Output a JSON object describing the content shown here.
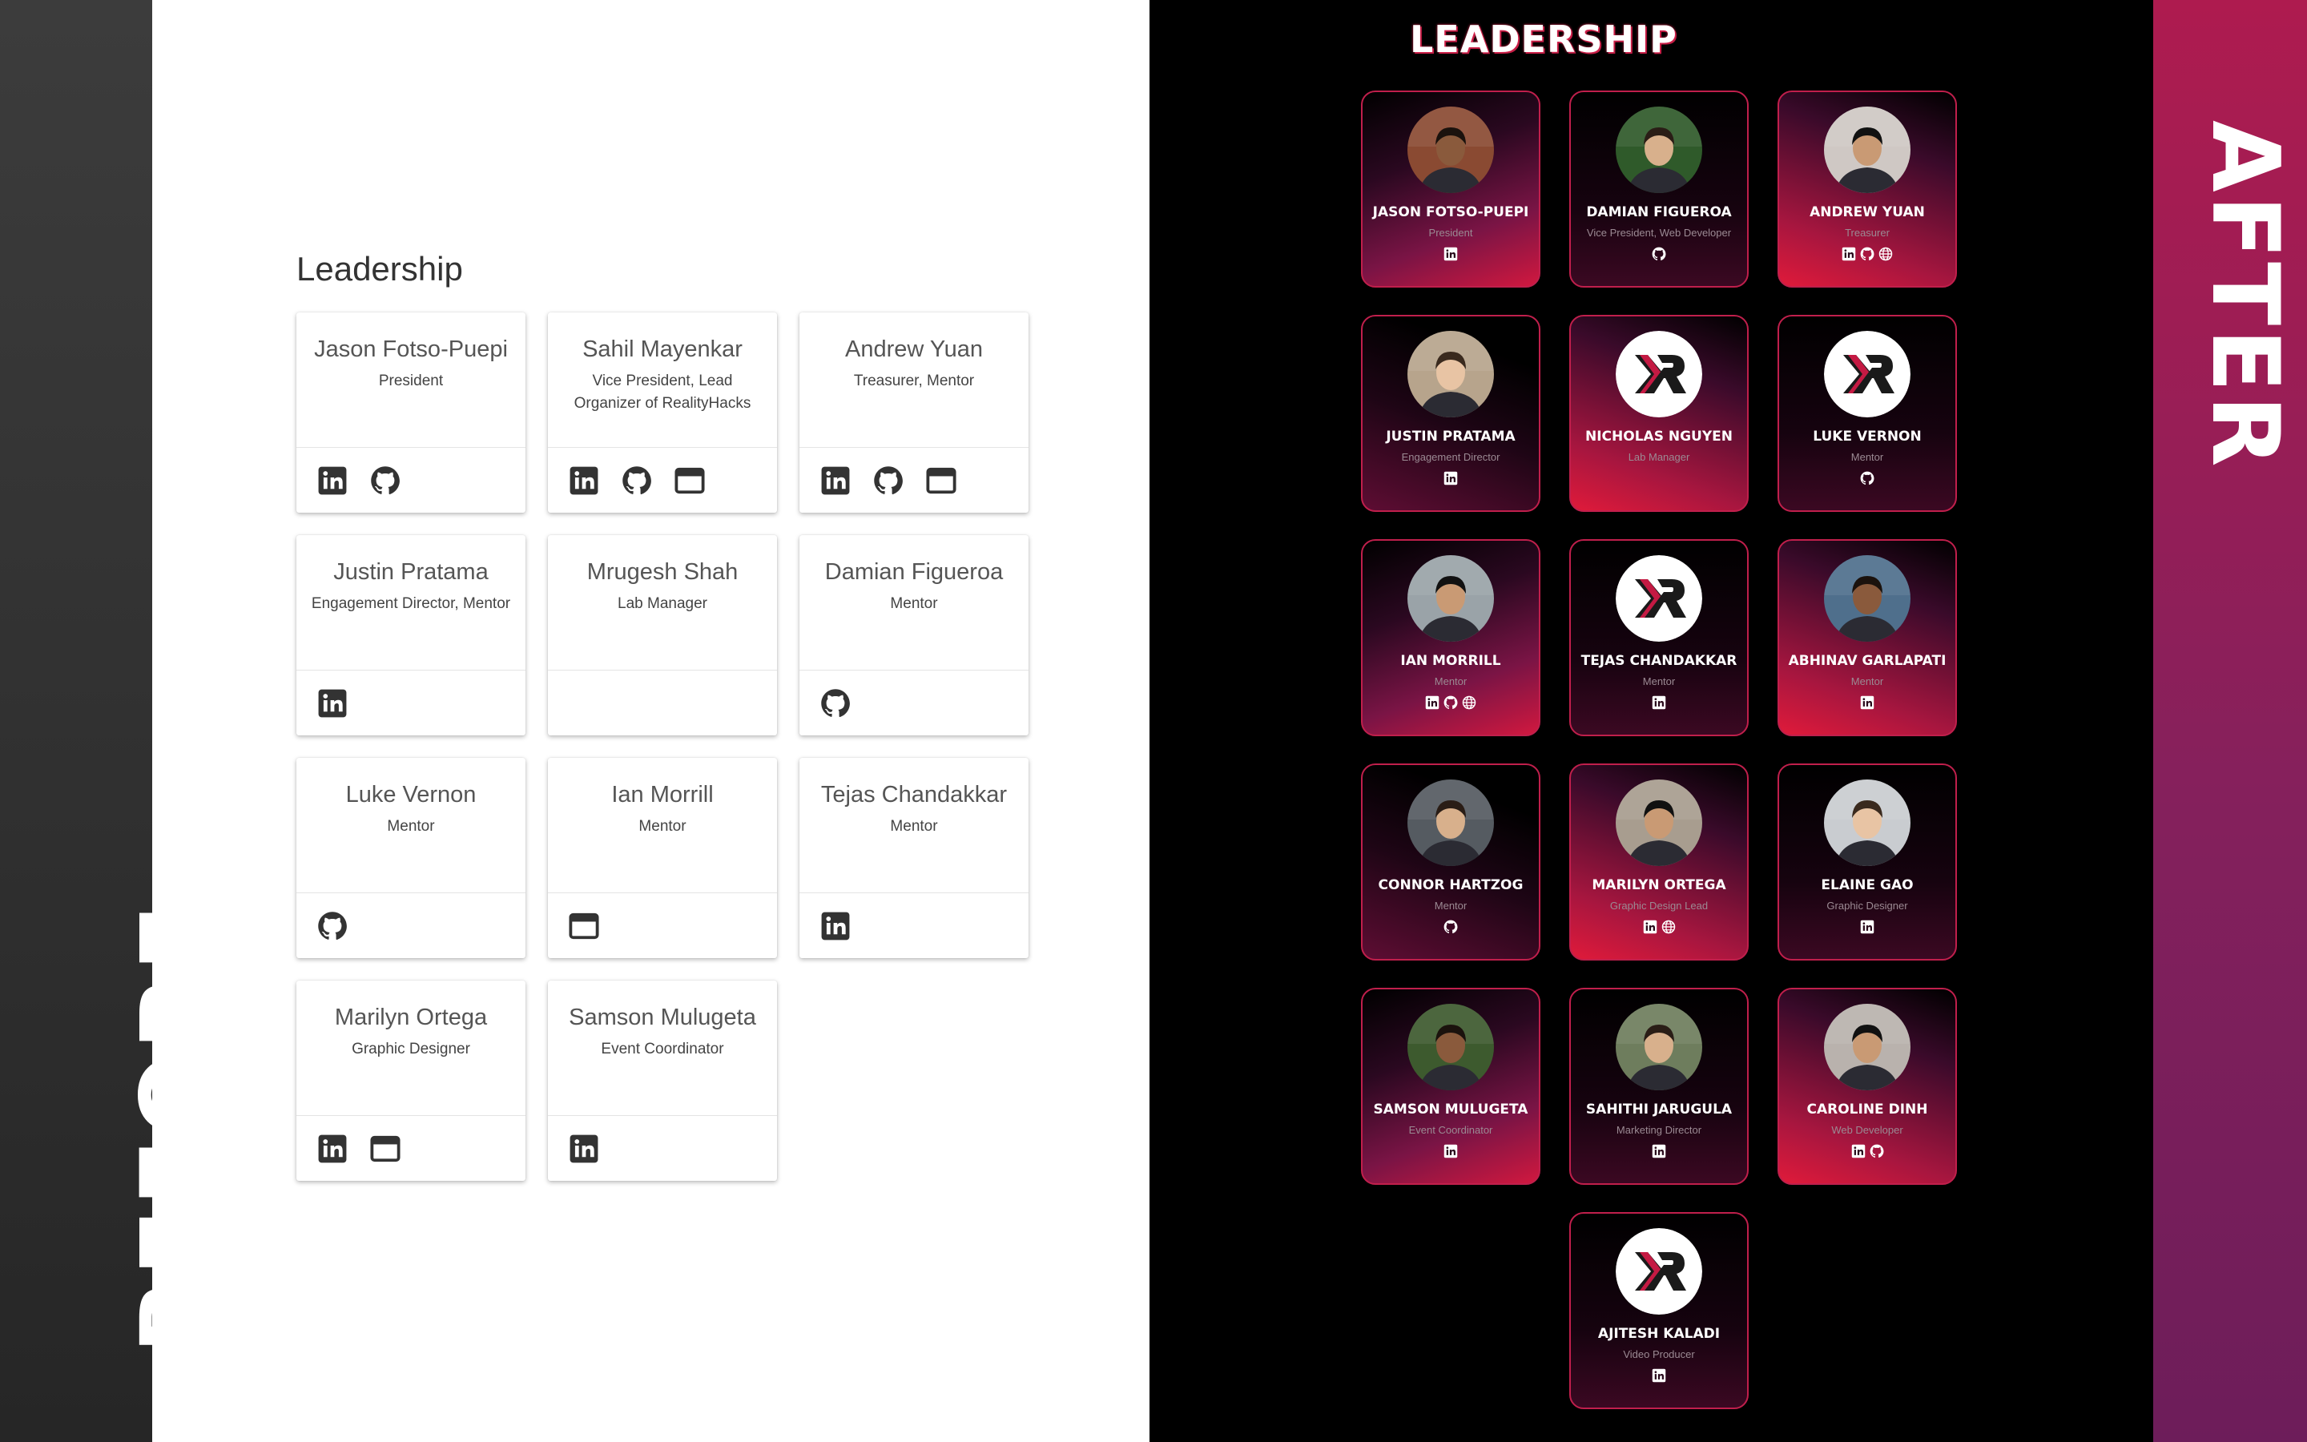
{
  "labels": {
    "before": "BEFORE",
    "after": "AFTER"
  },
  "before": {
    "heading": "Leadership",
    "cards": [
      {
        "name": "Jason Fotso-Puepi",
        "role": "President",
        "icons": [
          "linkedin-icon",
          "github-icon"
        ]
      },
      {
        "name": "Sahil Mayenkar",
        "role": "Vice President, Lead Organizer of RealityHacks",
        "icons": [
          "linkedin-icon",
          "github-icon",
          "website-icon"
        ]
      },
      {
        "name": "Andrew Yuan",
        "role": "Treasurer, Mentor",
        "icons": [
          "linkedin-icon",
          "github-icon",
          "website-icon"
        ]
      },
      {
        "name": "Justin Pratama",
        "role": "Engagement Director, Mentor",
        "icons": [
          "linkedin-icon"
        ]
      },
      {
        "name": "Mrugesh Shah",
        "role": "Lab Manager",
        "icons": []
      },
      {
        "name": "Damian Figueroa",
        "role": "Mentor",
        "icons": [
          "github-icon"
        ]
      },
      {
        "name": "Luke Vernon",
        "role": "Mentor",
        "icons": [
          "github-icon"
        ]
      },
      {
        "name": "Ian Morrill",
        "role": "Mentor",
        "icons": [
          "website-icon"
        ]
      },
      {
        "name": "Tejas Chandakkar",
        "role": "Mentor",
        "icons": [
          "linkedin-icon"
        ]
      },
      {
        "name": "Marilyn Ortega",
        "role": "Graphic Designer",
        "icons": [
          "linkedin-icon",
          "website-icon"
        ]
      },
      {
        "name": "Samson Mulugeta",
        "role": "Event Coordinator",
        "icons": [
          "linkedin-icon"
        ]
      }
    ]
  },
  "after": {
    "heading": "LEADERSHIP",
    "cards": [
      {
        "name": "JASON FOTSO-PUEPI",
        "role": "President",
        "avatar": "photo",
        "color": "#8a4a32",
        "icons": [
          "linkedin-icon"
        ]
      },
      {
        "name": "DAMIAN FIGUEROA",
        "role": "Vice President, Web Developer",
        "avatar": "photo",
        "color": "#2f5a2a",
        "icons": [
          "github-icon"
        ]
      },
      {
        "name": "ANDREW YUAN",
        "role": "Treasurer",
        "avatar": "photo",
        "color": "#cfc8c4",
        "icons": [
          "linkedin-icon",
          "github-icon",
          "globe-icon"
        ]
      },
      {
        "name": "JUSTIN PRATAMA",
        "role": "Engagement Director",
        "avatar": "photo",
        "color": "#b7a48c",
        "icons": [
          "linkedin-icon"
        ]
      },
      {
        "name": "NICHOLAS NGUYEN",
        "role": "Lab Manager",
        "avatar": "logo",
        "icons": []
      },
      {
        "name": "LUKE VERNON",
        "role": "Mentor",
        "avatar": "logo",
        "icons": [
          "github-icon"
        ]
      },
      {
        "name": "IAN MORRILL",
        "role": "Mentor",
        "avatar": "photo",
        "color": "#9aa3a8",
        "icons": [
          "linkedin-icon",
          "github-icon",
          "globe-icon"
        ]
      },
      {
        "name": "TEJAS CHANDAKKAR",
        "role": "Mentor",
        "avatar": "logo",
        "icons": [
          "linkedin-icon"
        ]
      },
      {
        "name": "ABHINAV GARLAPATI",
        "role": "Mentor",
        "avatar": "photo",
        "color": "#4f6f8c",
        "icons": [
          "linkedin-icon"
        ]
      },
      {
        "name": "CONNOR HARTZOG",
        "role": "Mentor",
        "avatar": "photo",
        "color": "#555b61",
        "icons": [
          "github-icon"
        ]
      },
      {
        "name": "MARILYN ORTEGA",
        "role": "Graphic Design Lead",
        "avatar": "photo",
        "color": "#a89d8f",
        "icons": [
          "linkedin-icon",
          "globe-icon"
        ]
      },
      {
        "name": "ELAINE GAO",
        "role": "Graphic Designer",
        "avatar": "photo",
        "color": "#c9ccd0",
        "icons": [
          "linkedin-icon"
        ]
      },
      {
        "name": "SAMSON MULUGETA",
        "role": "Event Coordinator",
        "avatar": "photo",
        "color": "#3d5a2e",
        "icons": [
          "linkedin-icon"
        ]
      },
      {
        "name": "SAHITHI JARUGULA",
        "role": "Marketing Director",
        "avatar": "photo",
        "color": "#6e7d5d",
        "icons": [
          "linkedin-icon"
        ]
      },
      {
        "name": "CAROLINE DINH",
        "role": "Web Developer",
        "avatar": "photo",
        "color": "#b9b2ad",
        "icons": [
          "linkedin-icon",
          "github-icon"
        ]
      },
      {
        "name": "AJITESH KALADI",
        "role": "Video Producer",
        "avatar": "logo",
        "icons": [
          "linkedin-icon"
        ]
      }
    ]
  }
}
